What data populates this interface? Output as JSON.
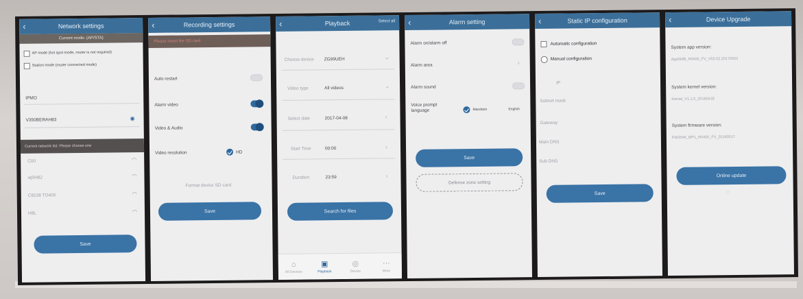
{
  "panels": {
    "network": {
      "title": "Network settings",
      "subtitle": "Current mode: (AP/STA)",
      "option_ap": "AP mode (hot spot mode, router is not required)",
      "option_sta": "Station mode (router connected mode)",
      "ssid_label": "IPMO",
      "password_value": "V350BERAH83",
      "hint": "Current network list: Please choose one",
      "networks": [
        "C00",
        "wj0H82",
        "C8108 TO400",
        "H8L"
      ],
      "save": "Save"
    },
    "recording": {
      "title": "Recording settings",
      "warning": "Please insert the SD card",
      "auto_restart": "Auto restart",
      "alarm_video": "Alarm video",
      "video_audio": "Video & Audio",
      "video_resolution": "Video resolution",
      "resolution_value": "HD",
      "format": "Format device SD card",
      "save": "Save"
    },
    "playback": {
      "title": "Playback",
      "right_action": "Select all",
      "choose_device_label": "Choose device",
      "choose_device_value": "ZG99UEH",
      "video_type_label": "Video type",
      "video_type_value": "All videos",
      "select_date_label": "Select date",
      "select_date_value": "2017-04-08",
      "start_time_label": "Start Time",
      "start_time_value": "00:00",
      "duration_label": "Duration",
      "duration_value": "23:59",
      "search": "Search for files",
      "tabs": [
        "All Devices",
        "Playback",
        "Device",
        "More"
      ]
    },
    "alarm": {
      "title": "Alarm setting",
      "alarm_on_off": "Alarm on/alarm off",
      "alarm_area": "Alarm area",
      "alarm_sound": "Alarm sound",
      "voice_label": "Voice prompt language",
      "lang_1": "Mandarin",
      "lang_2": "English",
      "save": "Save",
      "defense": "Defense zone setting"
    },
    "static_ip": {
      "title": "Static IP configuration",
      "auto": "Automatic configuration",
      "manual": "Manual configuration",
      "ip": "IP",
      "gateway": "Subnet mask",
      "subnet": "Gateway",
      "dns1": "Main DNS",
      "dns2": "Sub DNS",
      "save": "Save"
    },
    "upgrade": {
      "title": "Device Upgrade",
      "app_label": "System app version:",
      "app_value": "AppSMB_R0400_FV_V02.02.20170502",
      "kernel_label": "System kernel version:",
      "kernel_value": "Kernel_V1.1.0_20160418",
      "fw_label": "System firmware version:",
      "fw_value": "FW2546_MP1_R0400_FV_20160517",
      "button": "Online update"
    }
  }
}
